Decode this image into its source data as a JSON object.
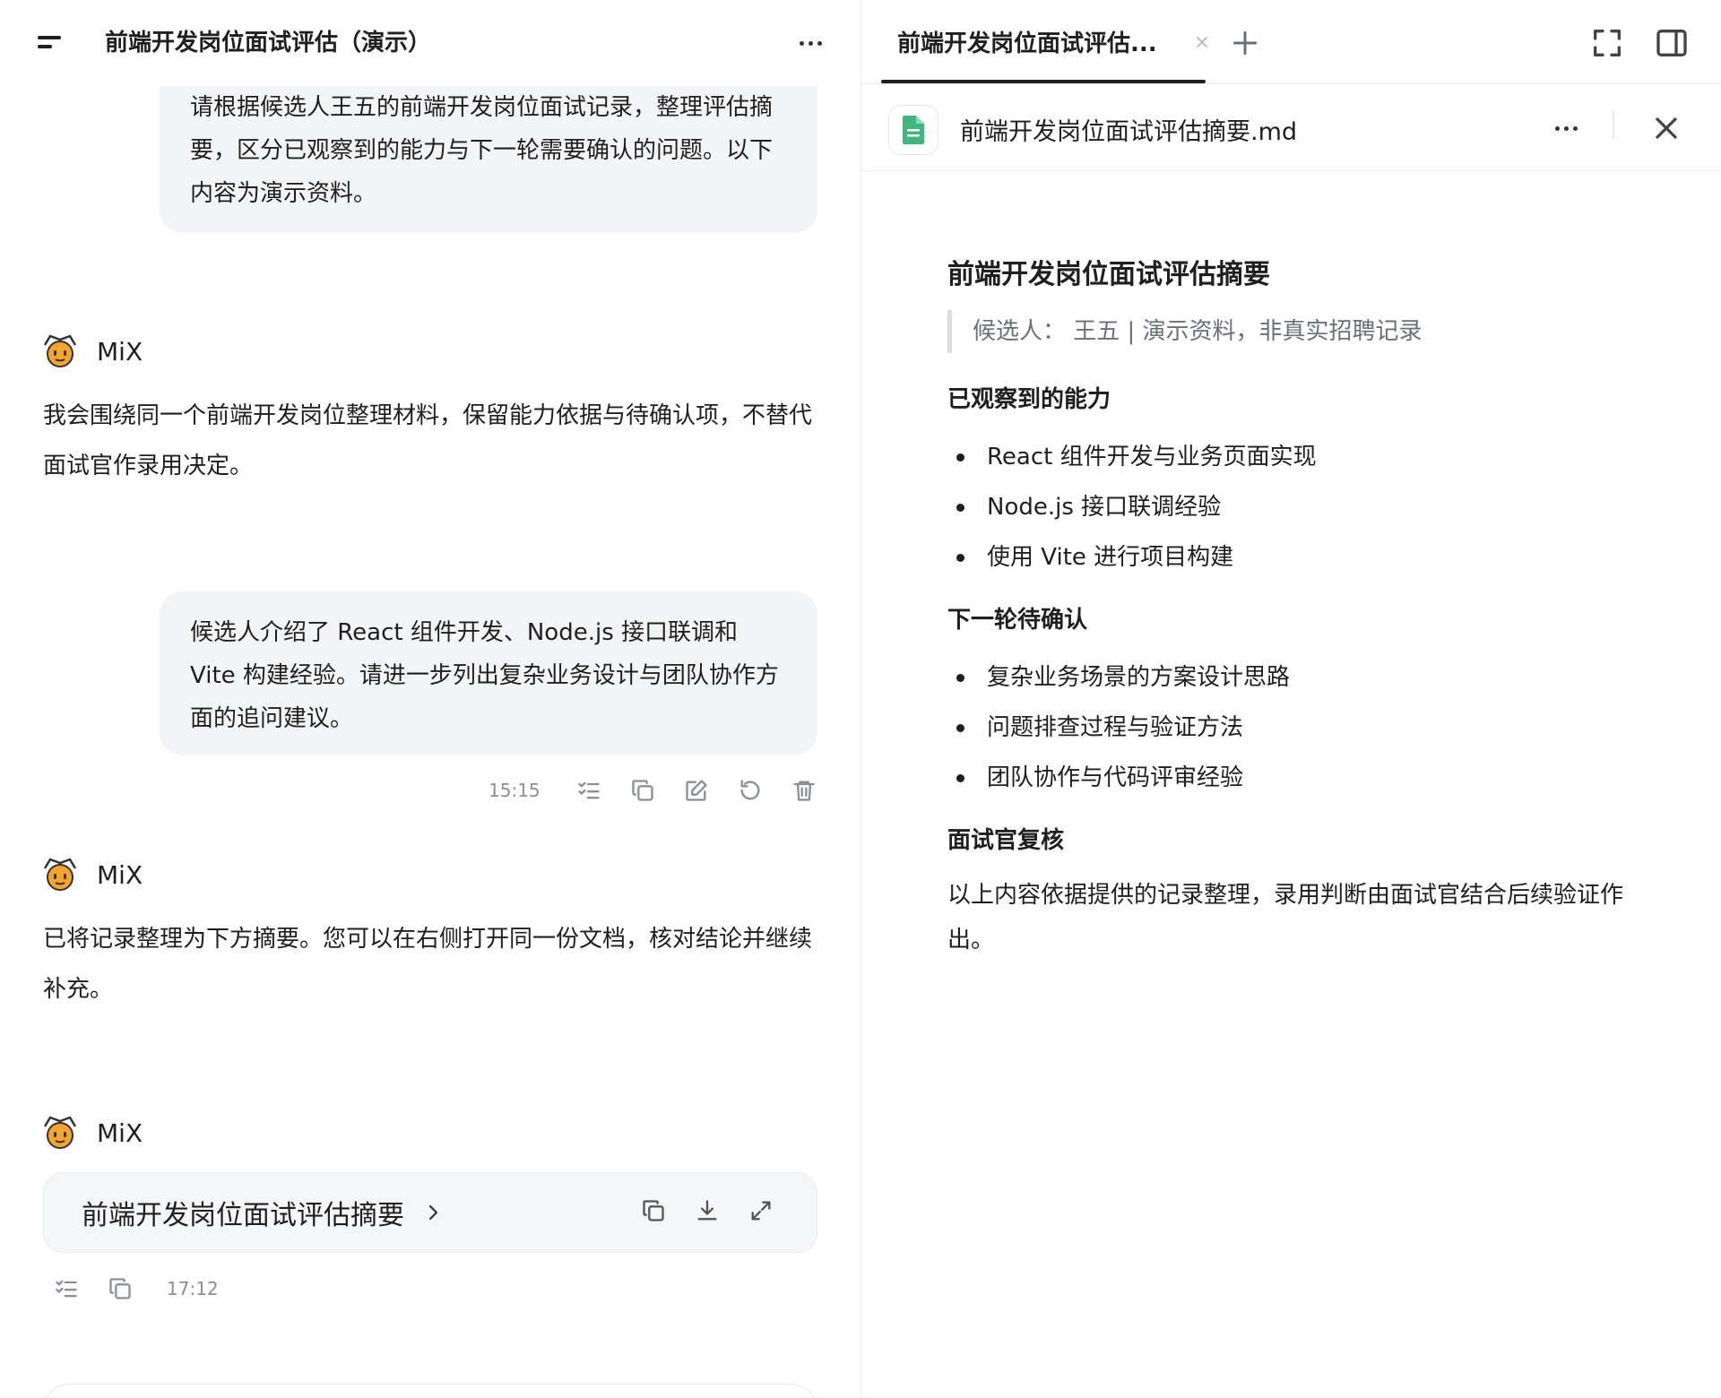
{
  "chat": {
    "title": "前端开发岗位面试评估（演示）",
    "messages": {
      "user1": "请根据候选人王五的前端开发岗位面试记录，整理评估摘要，区分已观察到的能力与下一轮需要确认的问题。以下内容为演示资料。",
      "bot1": "我会围绕同一个前端开发岗位整理材料，保留能力依据与待确认项，不替代面试官作录用决定。",
      "user2": "候选人介绍了 React 组件开发、Node.js 接口联调和 Vite 构建经验。请进一步列出复杂业务设计与团队协作方面的追问建议。",
      "user2_time": "15:15",
      "bot2": "已将记录整理为下方摘要。您可以在右侧打开同一份文档，核对结论并继续补充。",
      "bot3_time": "17:12"
    },
    "bot_name": "MiX",
    "doc_card_title": "前端开发岗位面试评估摘要"
  },
  "doc": {
    "tab_label": "前端开发岗位面试评估...",
    "file_name": "前端开发岗位面试评估摘要.md",
    "heading": "前端开发岗位面试评估摘要",
    "quote": "候选人： 王五 | 演示资料，非真实招聘记录",
    "section1": "已观察到的能力",
    "section1_items": [
      "React 组件开发与业务页面实现",
      "Node.js 接口联调经验",
      "使用 Vite 进行项目构建"
    ],
    "section2": "下一轮待确认",
    "section2_items": [
      "复杂业务场景的方案设计思路",
      "问题排查过程与验证方法",
      "团队协作与代码评审经验"
    ],
    "section3": "面试官复核",
    "section3_text": "以上内容依据提供的记录整理，录用判断由面试官结合后续验证作出。"
  },
  "colors": {
    "bubble_bg": "#f3f4f6",
    "muted": "#8a8f98",
    "file_icon": "#3fb77f",
    "avatar": "#f5a52e"
  }
}
